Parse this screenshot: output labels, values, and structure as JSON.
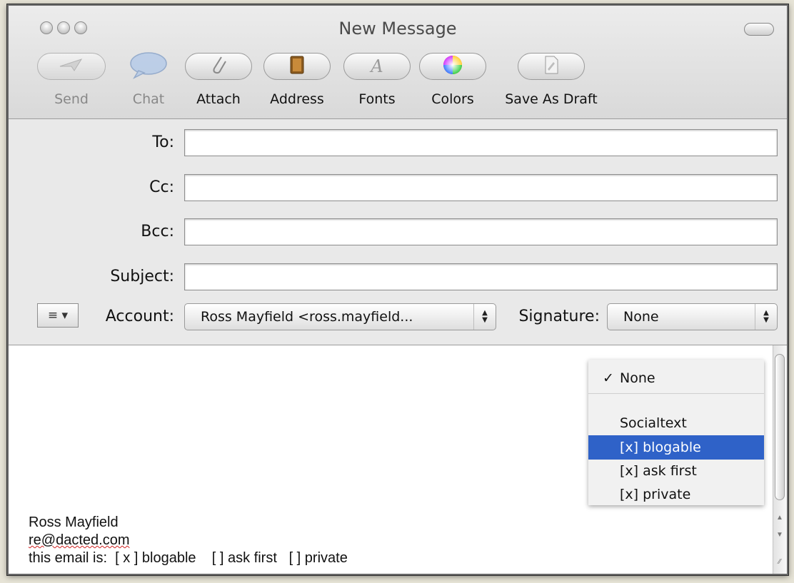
{
  "window": {
    "title": "New Message"
  },
  "toolbar": {
    "items": [
      {
        "label": "Send",
        "icon": "send-icon"
      },
      {
        "label": "Chat",
        "icon": "chat-bubble-icon"
      },
      {
        "label": "Attach",
        "icon": "paperclip-icon"
      },
      {
        "label": "Address",
        "icon": "address-book-icon"
      },
      {
        "label": "Fonts",
        "icon": "font-icon"
      },
      {
        "label": "Colors",
        "icon": "color-wheel-icon"
      },
      {
        "label": "Save As Draft",
        "icon": "draft-icon"
      }
    ]
  },
  "header": {
    "to_label": "To:",
    "to_value": "",
    "cc_label": "Cc:",
    "cc_value": "",
    "bcc_label": "Bcc:",
    "bcc_value": "",
    "subject_label": "Subject:",
    "subject_value": "",
    "action_menu_glyph": "≡ ▾",
    "account_label": "Account:",
    "account_value": "Ross Mayfield <ross.mayfield...",
    "signature_label": "Signature:",
    "signature_value": "None"
  },
  "signature_menu": {
    "checkmark": "✓",
    "items": [
      {
        "label": "None",
        "checked": true
      },
      {
        "label": "Socialtext"
      },
      {
        "label": "[x] blogable",
        "highlighted": true
      },
      {
        "label": "[x] ask first"
      },
      {
        "label": "[x] private"
      }
    ]
  },
  "body": {
    "line1": "Ross Mayfield",
    "line2": "re@dacted.com",
    "line3": "this email is:  [ x ] blogable    [ ] ask first   [ ] private"
  },
  "colors": {
    "menu_highlight": "#2f62c8"
  }
}
